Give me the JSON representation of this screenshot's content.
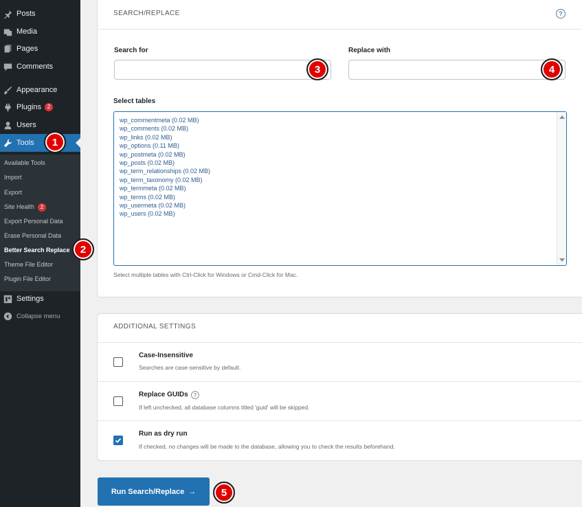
{
  "sidebar": {
    "items": [
      {
        "label": "Posts",
        "icon": "pin-icon"
      },
      {
        "label": "Media",
        "icon": "media-icon"
      },
      {
        "label": "Pages",
        "icon": "pages-icon"
      },
      {
        "label": "Comments",
        "icon": "comments-icon"
      },
      {
        "label": "Appearance",
        "icon": "brush-icon"
      },
      {
        "label": "Plugins",
        "icon": "plugin-icon",
        "badge": "2"
      },
      {
        "label": "Users",
        "icon": "user-icon"
      },
      {
        "label": "Tools",
        "icon": "wrench-icon",
        "active": true
      },
      {
        "label": "Settings",
        "icon": "settings-icon"
      },
      {
        "label": "Collapse menu",
        "icon": "collapse-icon"
      }
    ],
    "submenu": [
      {
        "label": "Available Tools"
      },
      {
        "label": "Import"
      },
      {
        "label": "Export"
      },
      {
        "label": "Site Health",
        "badge": "2"
      },
      {
        "label": "Export Personal Data"
      },
      {
        "label": "Erase Personal Data"
      },
      {
        "label": "Better Search Replace",
        "current": true
      },
      {
        "label": "Theme File Editor"
      },
      {
        "label": "Plugin File Editor"
      }
    ]
  },
  "steps": [
    "1",
    "2",
    "3",
    "4",
    "5"
  ],
  "search_replace": {
    "heading": "SEARCH/REPLACE",
    "help": "?",
    "search_label": "Search for",
    "search_value": "",
    "replace_label": "Replace with",
    "replace_value": "",
    "tables_label": "Select tables",
    "tables": [
      "wp_commentmeta (0.02 MB)",
      "wp_comments (0.02 MB)",
      "wp_links (0.02 MB)",
      "wp_options (0.11 MB)",
      "wp_postmeta (0.02 MB)",
      "wp_posts (0.02 MB)",
      "wp_term_relationships (0.02 MB)",
      "wp_term_taxonomy (0.02 MB)",
      "wp_termmeta (0.02 MB)",
      "wp_terms (0.02 MB)",
      "wp_usermeta (0.02 MB)",
      "wp_users (0.02 MB)"
    ],
    "tables_hint": "Select multiple tables with Ctrl-Click for Windows or Cmd-Click for Mac."
  },
  "additional": {
    "heading": "ADDITIONAL SETTINGS",
    "settings": [
      {
        "title": "Case-Insensitive",
        "desc": "Searches are case-sensitive by default.",
        "checked": false
      },
      {
        "title": "Replace GUIDs",
        "desc": "If left unchecked, all database columns titled 'guid' will be skipped.",
        "checked": false,
        "help": "?"
      },
      {
        "title": "Run as dry run",
        "desc": "If checked, no changes will be made to the database, allowing you to check the results beforehand.",
        "checked": true
      }
    ]
  },
  "run_button": {
    "label": "Run Search/Replace",
    "arrow": "→"
  },
  "colors": {
    "accent": "#2271b1",
    "sidebar": "#1d2327",
    "marker": "#e00000"
  }
}
